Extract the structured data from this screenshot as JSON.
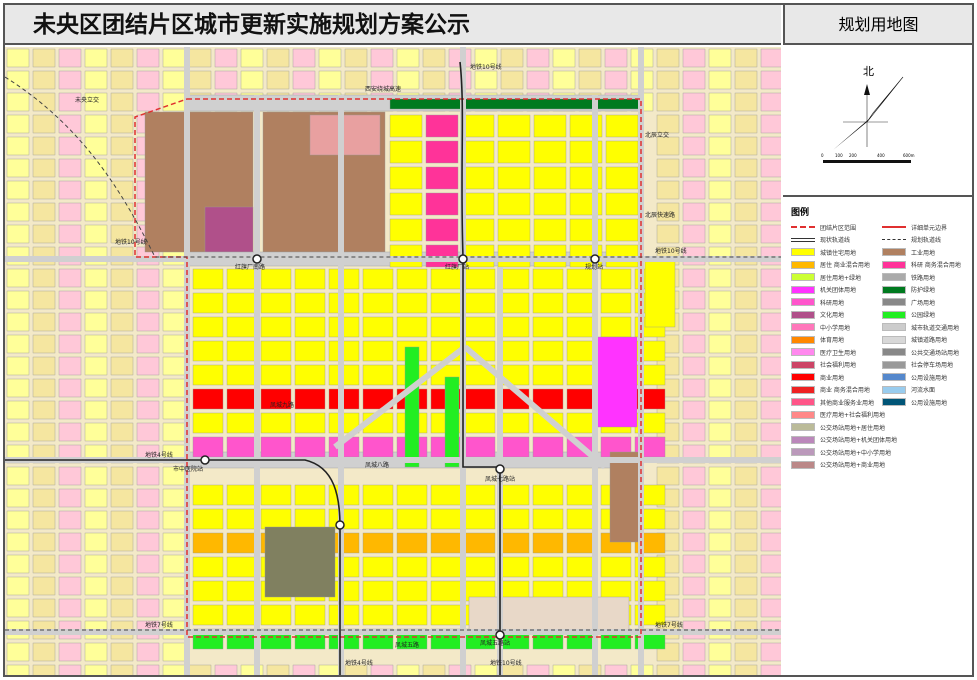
{
  "header": {
    "title": "未央区团结片区城市更新实施规划方案公示",
    "panel_title": "规划用地图"
  },
  "compass": {
    "north_label": "北",
    "scale_labels": [
      "0",
      "100",
      "200",
      "400",
      "600m"
    ]
  },
  "map_labels": {
    "metro10_top": "地铁10号线",
    "weiyang_interchange": "未央立交",
    "ring_expressway": "西安绕城高速",
    "beichen_interchange": "北辰立交",
    "metro10_left": "地铁10号线",
    "hongqichang_road": "红旗厂南路",
    "hongqi_station": "红旗厂站",
    "beichen_expressway": "北辰快速路",
    "metro10_right": "地铁10号线",
    "planned_station": "规划站",
    "metro4_left": "地铁4号线",
    "tcm_station": "市中医院站",
    "fengcheng_8": "凤城八路",
    "fengcheng_9": "凤城九路",
    "metro7_left": "地铁7号线",
    "metro7_right": "地铁7号线",
    "fengcheng_5": "凤城五路",
    "metro4_bottom": "地铁4号线",
    "metro10_bottom": "地铁10号线",
    "station_bottom": "凤城五路站",
    "station_mid": "凤城七路站"
  },
  "legend": {
    "title": "图例",
    "items": [
      {
        "label": "团结片区范围",
        "color": "dashed-red"
      },
      {
        "label": "详细单元边界",
        "color": "line-red"
      },
      {
        "label": "现状轨道线",
        "color": "line-double"
      },
      {
        "label": "规划轨道线",
        "color": "line-dotted"
      },
      {
        "label": "城镇住宅用地",
        "color": "#ffff00"
      },
      {
        "label": "工业用地",
        "color": "#b08060"
      },
      {
        "label": "居住 商业混合用地",
        "color": "#ffb800"
      },
      {
        "label": "科研 商务混合用地",
        "color": "#ff3399"
      },
      {
        "label": "居住用地+绿地",
        "color": "#ccff33"
      },
      {
        "label": "铁路用地",
        "color": "#aaaaaa"
      },
      {
        "label": "机关团体用地",
        "color": "#ff33ff"
      },
      {
        "label": "防护绿地",
        "color": "#007a1f"
      },
      {
        "label": "科研用地",
        "color": "#ff55cc"
      },
      {
        "label": "广场用地",
        "color": "#888888"
      },
      {
        "label": "文化用地",
        "color": "#b0508a"
      },
      {
        "label": "公园绿地",
        "color": "#22ee22"
      },
      {
        "label": "中小学用地",
        "color": "#ff77bb"
      },
      {
        "label": "城市轨道交通用地",
        "color": "#cccccc"
      },
      {
        "label": "体育用地",
        "color": "#ff8800"
      },
      {
        "label": "城镇道路用地",
        "color": "#d8d8d8"
      },
      {
        "label": "医疗卫生用地",
        "color": "#ff88ee"
      },
      {
        "label": "公共交通场站用地",
        "color": "#888888"
      },
      {
        "label": "社会福利用地",
        "color": "#cc4466"
      },
      {
        "label": "社会停车场用地",
        "color": "#999999"
      },
      {
        "label": "商业用地",
        "color": "#ff0000"
      },
      {
        "label": "公用设施用地",
        "color": "#5588cc"
      },
      {
        "label": "商业 商务混合用地",
        "color": "#ee2222"
      },
      {
        "label": "河流水面",
        "color": "#99ccee"
      },
      {
        "label": "其他商业服务业用地",
        "color": "#ff5588"
      },
      {
        "label": "公用设施用地",
        "color": "#005577"
      },
      {
        "label": "医疗用地+社会福利用地",
        "color": "#ff8888",
        "wide": true
      },
      {
        "label": "公交场站用地+居住用地",
        "color": "#bbbb99",
        "wide": true
      },
      {
        "label": "公交场站用地+机关团体用地",
        "color": "#bb88bb",
        "wide": true
      },
      {
        "label": "公交场站用地+中小学用地",
        "color": "#bb99bb",
        "wide": true
      },
      {
        "label": "公交场站用地+商业用地",
        "color": "#bb8888",
        "wide": true
      }
    ]
  }
}
